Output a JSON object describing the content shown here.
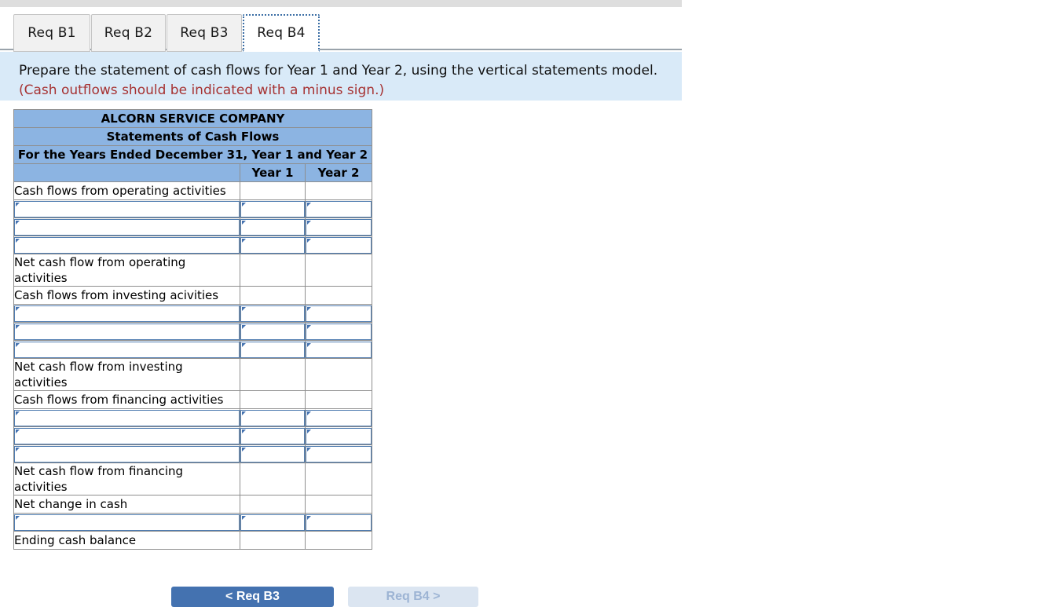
{
  "tabs": [
    {
      "label": "Req B1",
      "active": false
    },
    {
      "label": "Req B2",
      "active": false
    },
    {
      "label": "Req B3",
      "active": false
    },
    {
      "label": "Req B4",
      "active": true
    }
  ],
  "instruction": {
    "text": "Prepare the statement of cash flows for Year 1 and Year 2, using the vertical statements model.",
    "note": "(Cash outflows should be indicated with a minus sign.)"
  },
  "statement": {
    "company": "ALCORN SERVICE COMPANY",
    "title": "Statements of Cash Flows",
    "period": "For the Years Ended December 31, Year 1 and Year 2",
    "columns": [
      "",
      "Year 1",
      "Year 2"
    ],
    "rows": [
      {
        "label": "Cash flows from operating activities",
        "type": "section",
        "value_year1": "",
        "value_year2": ""
      },
      {
        "label": "",
        "type": "input",
        "value_year1": "",
        "value_year2": ""
      },
      {
        "label": "",
        "type": "input",
        "value_year1": "",
        "value_year2": ""
      },
      {
        "label": "",
        "type": "input",
        "value_year1": "",
        "value_year2": "",
        "rule": "bottom"
      },
      {
        "label": "Net cash flow from operating activities",
        "type": "subtotal",
        "value_year1": "",
        "value_year2": "",
        "rule": "bottom"
      },
      {
        "label": "Cash flows from investing acivities",
        "type": "section",
        "value_year1": "",
        "value_year2": ""
      },
      {
        "label": "",
        "type": "input",
        "value_year1": "",
        "value_year2": ""
      },
      {
        "label": "",
        "type": "input",
        "value_year1": "",
        "value_year2": ""
      },
      {
        "label": "",
        "type": "input",
        "value_year1": "",
        "value_year2": "",
        "rule": "bottom"
      },
      {
        "label": "Net cash flow from investing activities",
        "type": "subtotal",
        "value_year1": "",
        "value_year2": "",
        "rule": "bottom"
      },
      {
        "label": "Cash flows from financing activities",
        "type": "section",
        "value_year1": "",
        "value_year2": ""
      },
      {
        "label": "",
        "type": "input",
        "value_year1": "",
        "value_year2": ""
      },
      {
        "label": "",
        "type": "input",
        "value_year1": "",
        "value_year2": ""
      },
      {
        "label": "",
        "type": "input",
        "value_year1": "",
        "value_year2": "",
        "rule": "bottom"
      },
      {
        "label": "Net cash flow from financing activities",
        "type": "subtotal",
        "value_year1": "",
        "value_year2": "",
        "rule": "bottom"
      },
      {
        "label": "Net change in cash",
        "type": "section",
        "value_year1": "",
        "value_year2": ""
      },
      {
        "label": "",
        "type": "input",
        "value_year1": "",
        "value_year2": ""
      },
      {
        "label": "Ending cash balance",
        "type": "subtotal",
        "value_year1": "",
        "value_year2": "",
        "rule": "bottom"
      }
    ]
  },
  "nav": {
    "prev_label": "< Req B3",
    "next_label": "Req B4 >"
  },
  "colors": {
    "header_blue": "#8cb4e2",
    "banner_blue": "#d9eaf8",
    "note_red": "#a63232",
    "accent_blue": "#4472b0",
    "input_border": "#4f7cb0"
  }
}
